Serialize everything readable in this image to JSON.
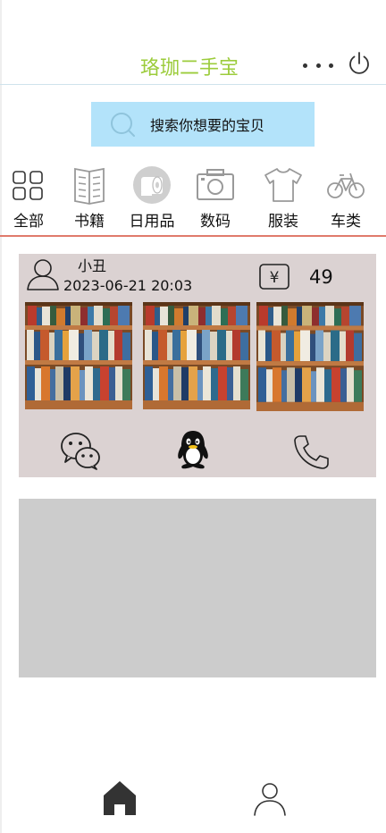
{
  "header": {
    "title": "珞珈二手宝",
    "title_color": "#9ccc3c",
    "more_icon": "more-dots-icon",
    "power_icon": "power-icon"
  },
  "search": {
    "placeholder": "搜索你想要的宝贝",
    "background": "#b3e3fa",
    "icon": "search-icon"
  },
  "categories": [
    {
      "label": "全部",
      "icon": "grid-icon"
    },
    {
      "label": "书籍",
      "icon": "book-icon"
    },
    {
      "label": "日用品",
      "icon": "tissue-roll-icon"
    },
    {
      "label": "数码",
      "icon": "camera-icon"
    },
    {
      "label": "服装",
      "icon": "tshirt-icon"
    },
    {
      "label": "车类",
      "icon": "bicycle-icon"
    }
  ],
  "listings": [
    {
      "username": "小丑",
      "time": "2023-06-21 20:03",
      "price_symbol": "¥",
      "price": "49",
      "photos": [
        "bookshelf-photo",
        "bookshelf-photo",
        "bookshelf-photo"
      ],
      "contacts": [
        "wechat-icon",
        "qq-icon",
        "phone-icon"
      ]
    }
  ],
  "nav": {
    "items": [
      {
        "name": "home",
        "icon": "home-icon",
        "active": true
      },
      {
        "name": "profile",
        "icon": "user-icon",
        "active": false
      }
    ]
  },
  "colors": {
    "card_bg": "#dbd2d2",
    "placeholder_card_bg": "#cccccc",
    "divider": "#e07a6c"
  }
}
